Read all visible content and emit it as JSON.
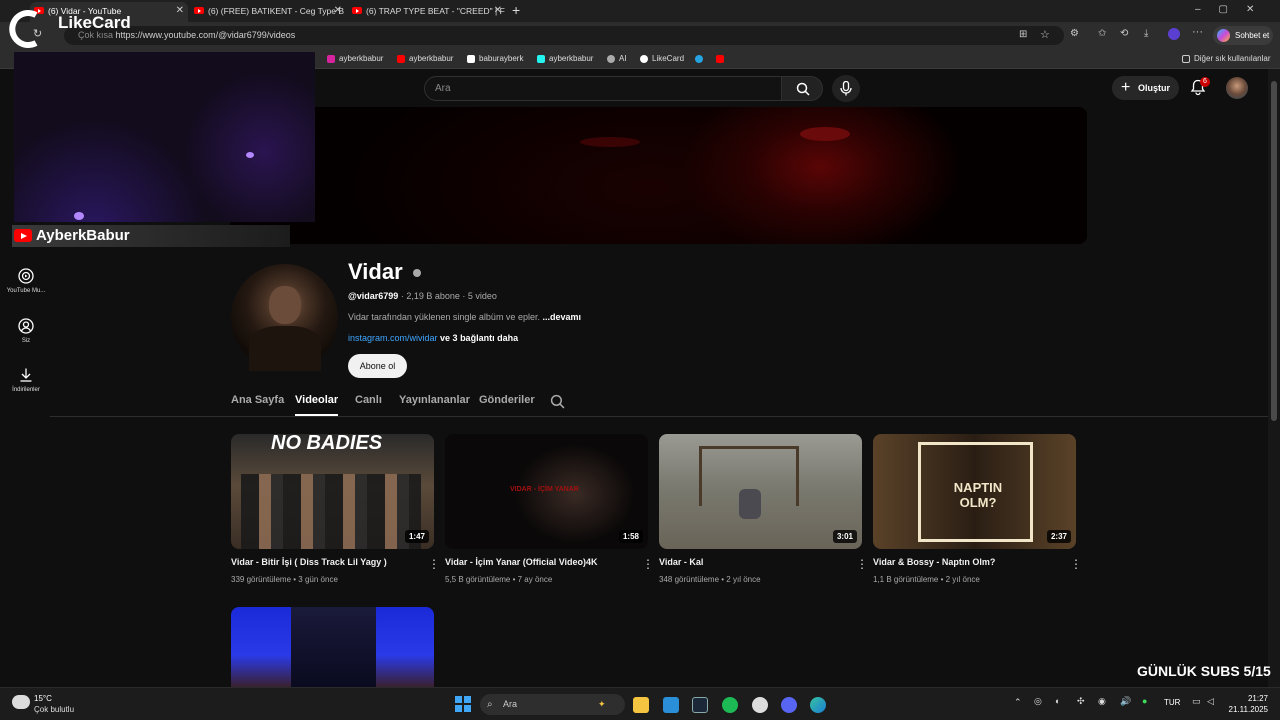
{
  "browser": {
    "tabs": [
      {
        "title": "(6) Vidar - YouTube",
        "active": true
      },
      {
        "title": "(6) (FREE) BATIKENT - Ceg Type B",
        "active": false
      },
      {
        "title": "(6) TRAP TYPE BEAT - \"CREED\" | F",
        "active": false
      }
    ],
    "new_tab": "+",
    "url": "https://www.youtube.com/@vidar6799/videos",
    "url_prefix": "Çok kısa",
    "chat_button": "Sohbet et",
    "bookmarks": [
      {
        "label": "ayberkbabur",
        "color": "#d6249f"
      },
      {
        "label": "ayberkbabur",
        "color": "#ff0000"
      },
      {
        "label": "baburayberk",
        "color": "#ffffff"
      },
      {
        "label": "ayberkbabur",
        "color": "#25f4ee"
      },
      {
        "label": "AI",
        "color": "#aaaaaa"
      },
      {
        "label": "LikeCard",
        "color": "#ffffff"
      }
    ],
    "other_bookmarks": "Diğer sık kullanılanlar"
  },
  "youtube": {
    "search_placeholder": "Ara",
    "create_label": "Oluştur",
    "notification_count": "6",
    "sidebar": [
      {
        "label": "YouTube Mu...",
        "icon": "youtube-music-icon"
      },
      {
        "label": "Siz",
        "icon": "user-icon"
      },
      {
        "label": "İndirilenler",
        "icon": "download-icon"
      }
    ],
    "channel": {
      "name": "Vidar",
      "handle": "@vidar6799",
      "stats": "· 2,19 B abone · 5 video",
      "description": "Vidar tarafından yüklenen single albüm ve epler.",
      "description_more": "...devamı",
      "link": "instagram.com/wividar",
      "link_more": "ve 3 bağlantı daha",
      "subscribe_label": "Abone ol"
    },
    "tabs": [
      "Ana Sayfa",
      "Videolar",
      "Canlı",
      "Yayınlananlar",
      "Gönderiler"
    ],
    "active_tab": "Videolar",
    "videos": [
      {
        "title": "Vidar - Bitir İşi ( Diss Track Lil Yagy )",
        "views": "339 görüntüleme",
        "age": "3 gün önce",
        "duration": "1:47",
        "thumb_text": "NO BADIES"
      },
      {
        "title": "Vidar - İçim Yanar (Official Video)4K",
        "views": "5,5 B görüntüleme",
        "age": "7 ay önce",
        "duration": "1:58",
        "thumb_text": "VIDAR - İÇİM YANAR"
      },
      {
        "title": "Vidar - Kal",
        "views": "348 görüntüleme",
        "age": "2 yıl önce",
        "duration": "3:01",
        "thumb_text": ""
      },
      {
        "title": "Vidar & Bossy - Naptın Olm?",
        "views": "1,1 B görüntüleme",
        "age": "2 yıl önce",
        "duration": "2:37",
        "thumb_text": "NAPTIN OLM?"
      }
    ]
  },
  "overlay": {
    "streamer_name": "AyberkBabur",
    "likecard": "LikeCard",
    "subs_goal": "GÜNLÜK SUBS 5/15"
  },
  "taskbar": {
    "weather_temp": "15°C",
    "weather_desc": "Çok bulutlu",
    "search": "Ara",
    "lang": "TUR",
    "time": "21:27",
    "date": "21.11.2025"
  }
}
